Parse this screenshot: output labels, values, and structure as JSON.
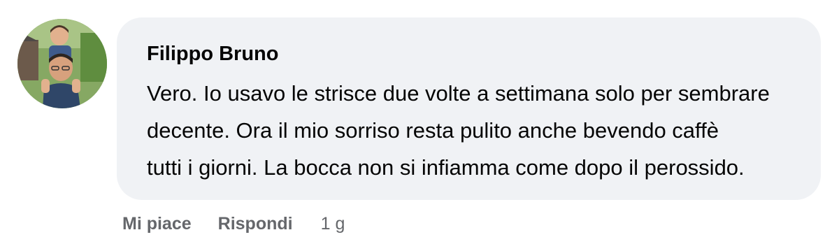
{
  "comment": {
    "author": "Filippo Bruno",
    "text_lines": [
      "Vero. Io usavo le strisce due volte a settimana solo per sembrare",
      "decente. Ora il mio sorriso resta pulito anche bevendo caffè",
      "tutti i giorni. La bocca non si infiamma come dopo il perossido."
    ],
    "avatar_icon": "profile-photo-avatar",
    "actions": {
      "like_label": "Mi piace",
      "reply_label": "Rispondi",
      "timestamp": "1 g"
    }
  },
  "colors": {
    "bubble_background": "#f0f2f5",
    "text": "#050505",
    "secondary_text": "#65676b"
  }
}
